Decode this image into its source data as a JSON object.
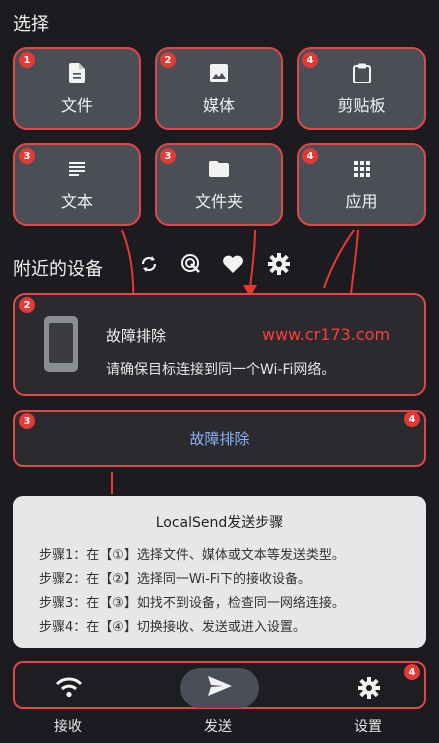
{
  "header": {
    "select_title": "选择"
  },
  "selection": {
    "items": [
      {
        "label": "文件",
        "icon": "file-icon",
        "badge": "1"
      },
      {
        "label": "媒体",
        "icon": "image-icon",
        "badge": "2"
      },
      {
        "label": "剪贴板",
        "icon": "clipboard-icon",
        "badge": "4"
      },
      {
        "label": "文本",
        "icon": "text-icon",
        "badge": "3"
      },
      {
        "label": "文件夹",
        "icon": "folder-icon",
        "badge": "3"
      },
      {
        "label": "应用",
        "icon": "apps-grid-icon",
        "badge": "4"
      }
    ]
  },
  "nearby": {
    "title": "附近的设备",
    "icons": [
      "refresh-icon",
      "scan-icon",
      "heart-icon",
      "gear-icon"
    ]
  },
  "device_card": {
    "badge": "2",
    "title": "故障排除",
    "subtitle": "请确保目标连接到同一个Wi-Fi网络。",
    "watermark": "www.cr173.com"
  },
  "troubleshoot": {
    "label": "故障排除",
    "badge_left": "3",
    "badge_right": "4"
  },
  "steps": {
    "title": "LocalSend发送步骤",
    "lines": [
      "步骤1：在【①】选择文件、媒体或文本等发送类型。",
      "步骤2：在【②】选择同一Wi-Fi下的接收设备。",
      "步骤3：在【③】如找不到设备，检查同一网络连接。",
      "步骤4：在【④】切换接收、发送或进入设置。"
    ]
  },
  "bottom_nav": {
    "badge": "4",
    "items": [
      {
        "label": "接收",
        "icon": "wifi-icon"
      },
      {
        "label": "发送",
        "icon": "send-icon"
      },
      {
        "label": "设置",
        "icon": "gear-icon"
      }
    ]
  },
  "colors": {
    "accent_red": "#e04848",
    "card_bg": "#4a4e55",
    "link_blue": "#8ab4f8",
    "watermark_red": "#ff3b3b"
  }
}
